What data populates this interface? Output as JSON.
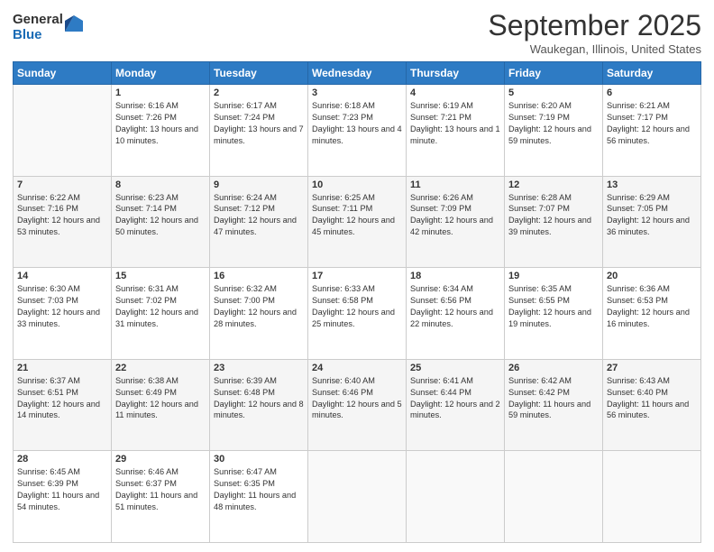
{
  "logo": {
    "general": "General",
    "blue": "Blue"
  },
  "header": {
    "month": "September 2025",
    "location": "Waukegan, Illinois, United States"
  },
  "weekdays": [
    "Sunday",
    "Monday",
    "Tuesday",
    "Wednesday",
    "Thursday",
    "Friday",
    "Saturday"
  ],
  "weeks": [
    [
      {
        "day": "",
        "sunrise": "",
        "sunset": "",
        "daylight": ""
      },
      {
        "day": "1",
        "sunrise": "Sunrise: 6:16 AM",
        "sunset": "Sunset: 7:26 PM",
        "daylight": "Daylight: 13 hours and 10 minutes."
      },
      {
        "day": "2",
        "sunrise": "Sunrise: 6:17 AM",
        "sunset": "Sunset: 7:24 PM",
        "daylight": "Daylight: 13 hours and 7 minutes."
      },
      {
        "day": "3",
        "sunrise": "Sunrise: 6:18 AM",
        "sunset": "Sunset: 7:23 PM",
        "daylight": "Daylight: 13 hours and 4 minutes."
      },
      {
        "day": "4",
        "sunrise": "Sunrise: 6:19 AM",
        "sunset": "Sunset: 7:21 PM",
        "daylight": "Daylight: 13 hours and 1 minute."
      },
      {
        "day": "5",
        "sunrise": "Sunrise: 6:20 AM",
        "sunset": "Sunset: 7:19 PM",
        "daylight": "Daylight: 12 hours and 59 minutes."
      },
      {
        "day": "6",
        "sunrise": "Sunrise: 6:21 AM",
        "sunset": "Sunset: 7:17 PM",
        "daylight": "Daylight: 12 hours and 56 minutes."
      }
    ],
    [
      {
        "day": "7",
        "sunrise": "Sunrise: 6:22 AM",
        "sunset": "Sunset: 7:16 PM",
        "daylight": "Daylight: 12 hours and 53 minutes."
      },
      {
        "day": "8",
        "sunrise": "Sunrise: 6:23 AM",
        "sunset": "Sunset: 7:14 PM",
        "daylight": "Daylight: 12 hours and 50 minutes."
      },
      {
        "day": "9",
        "sunrise": "Sunrise: 6:24 AM",
        "sunset": "Sunset: 7:12 PM",
        "daylight": "Daylight: 12 hours and 47 minutes."
      },
      {
        "day": "10",
        "sunrise": "Sunrise: 6:25 AM",
        "sunset": "Sunset: 7:11 PM",
        "daylight": "Daylight: 12 hours and 45 minutes."
      },
      {
        "day": "11",
        "sunrise": "Sunrise: 6:26 AM",
        "sunset": "Sunset: 7:09 PM",
        "daylight": "Daylight: 12 hours and 42 minutes."
      },
      {
        "day": "12",
        "sunrise": "Sunrise: 6:28 AM",
        "sunset": "Sunset: 7:07 PM",
        "daylight": "Daylight: 12 hours and 39 minutes."
      },
      {
        "day": "13",
        "sunrise": "Sunrise: 6:29 AM",
        "sunset": "Sunset: 7:05 PM",
        "daylight": "Daylight: 12 hours and 36 minutes."
      }
    ],
    [
      {
        "day": "14",
        "sunrise": "Sunrise: 6:30 AM",
        "sunset": "Sunset: 7:03 PM",
        "daylight": "Daylight: 12 hours and 33 minutes."
      },
      {
        "day": "15",
        "sunrise": "Sunrise: 6:31 AM",
        "sunset": "Sunset: 7:02 PM",
        "daylight": "Daylight: 12 hours and 31 minutes."
      },
      {
        "day": "16",
        "sunrise": "Sunrise: 6:32 AM",
        "sunset": "Sunset: 7:00 PM",
        "daylight": "Daylight: 12 hours and 28 minutes."
      },
      {
        "day": "17",
        "sunrise": "Sunrise: 6:33 AM",
        "sunset": "Sunset: 6:58 PM",
        "daylight": "Daylight: 12 hours and 25 minutes."
      },
      {
        "day": "18",
        "sunrise": "Sunrise: 6:34 AM",
        "sunset": "Sunset: 6:56 PM",
        "daylight": "Daylight: 12 hours and 22 minutes."
      },
      {
        "day": "19",
        "sunrise": "Sunrise: 6:35 AM",
        "sunset": "Sunset: 6:55 PM",
        "daylight": "Daylight: 12 hours and 19 minutes."
      },
      {
        "day": "20",
        "sunrise": "Sunrise: 6:36 AM",
        "sunset": "Sunset: 6:53 PM",
        "daylight": "Daylight: 12 hours and 16 minutes."
      }
    ],
    [
      {
        "day": "21",
        "sunrise": "Sunrise: 6:37 AM",
        "sunset": "Sunset: 6:51 PM",
        "daylight": "Daylight: 12 hours and 14 minutes."
      },
      {
        "day": "22",
        "sunrise": "Sunrise: 6:38 AM",
        "sunset": "Sunset: 6:49 PM",
        "daylight": "Daylight: 12 hours and 11 minutes."
      },
      {
        "day": "23",
        "sunrise": "Sunrise: 6:39 AM",
        "sunset": "Sunset: 6:48 PM",
        "daylight": "Daylight: 12 hours and 8 minutes."
      },
      {
        "day": "24",
        "sunrise": "Sunrise: 6:40 AM",
        "sunset": "Sunset: 6:46 PM",
        "daylight": "Daylight: 12 hours and 5 minutes."
      },
      {
        "day": "25",
        "sunrise": "Sunrise: 6:41 AM",
        "sunset": "Sunset: 6:44 PM",
        "daylight": "Daylight: 12 hours and 2 minutes."
      },
      {
        "day": "26",
        "sunrise": "Sunrise: 6:42 AM",
        "sunset": "Sunset: 6:42 PM",
        "daylight": "Daylight: 11 hours and 59 minutes."
      },
      {
        "day": "27",
        "sunrise": "Sunrise: 6:43 AM",
        "sunset": "Sunset: 6:40 PM",
        "daylight": "Daylight: 11 hours and 56 minutes."
      }
    ],
    [
      {
        "day": "28",
        "sunrise": "Sunrise: 6:45 AM",
        "sunset": "Sunset: 6:39 PM",
        "daylight": "Daylight: 11 hours and 54 minutes."
      },
      {
        "day": "29",
        "sunrise": "Sunrise: 6:46 AM",
        "sunset": "Sunset: 6:37 PM",
        "daylight": "Daylight: 11 hours and 51 minutes."
      },
      {
        "day": "30",
        "sunrise": "Sunrise: 6:47 AM",
        "sunset": "Sunset: 6:35 PM",
        "daylight": "Daylight: 11 hours and 48 minutes."
      },
      {
        "day": "",
        "sunrise": "",
        "sunset": "",
        "daylight": ""
      },
      {
        "day": "",
        "sunrise": "",
        "sunset": "",
        "daylight": ""
      },
      {
        "day": "",
        "sunrise": "",
        "sunset": "",
        "daylight": ""
      },
      {
        "day": "",
        "sunrise": "",
        "sunset": "",
        "daylight": ""
      }
    ]
  ]
}
